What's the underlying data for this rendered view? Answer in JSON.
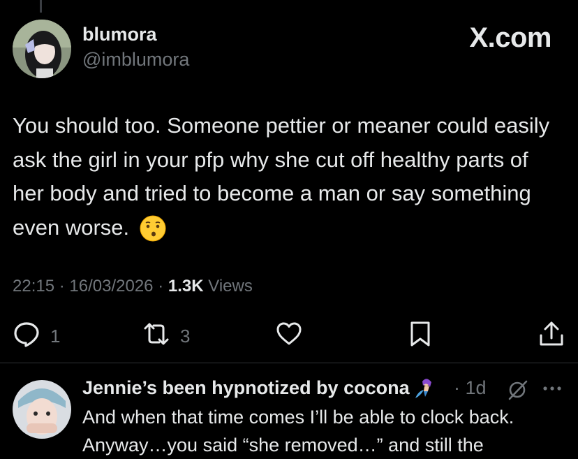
{
  "post": {
    "author": {
      "display_name": "blumora",
      "handle": "@imblumora"
    },
    "site_watermark": "X.com",
    "text": "You should too. Someone pettier or meaner could easily ask the girl in your pfp why she cut off healthy parts of her body and tried to become a man or say something even worse.",
    "emoji_icon": "kissing-face-icon",
    "time": "22:15",
    "date": "16/03/2026",
    "separator": "·",
    "views_count": "1.3K",
    "views_label": "Views"
  },
  "actions": {
    "reply_count": "1",
    "repost_count": "3",
    "like_count": "",
    "icons": [
      "reply-icon",
      "repost-icon",
      "like-icon",
      "bookmark-icon",
      "share-icon"
    ]
  },
  "reply": {
    "display_name": "Jennie’s been hypnotized by cocona",
    "name_emoji_icon": "mermaid-emoji-icon",
    "time": "· 1d",
    "text": "And when that time comes I’ll be able to clock back.",
    "text_line2": "Anyway…you said “she removed…” and still the"
  },
  "colors": {
    "background": "#000000",
    "primary_text": "#e7e9ea",
    "secondary_text": "#71767b",
    "divider": "#2f3336"
  }
}
